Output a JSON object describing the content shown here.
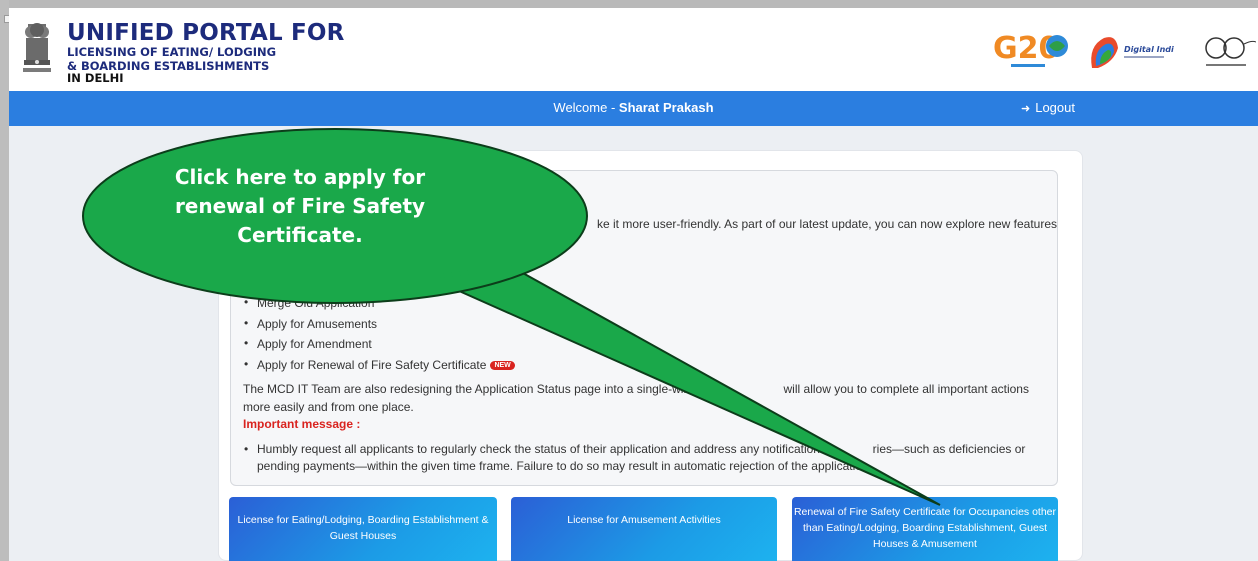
{
  "header": {
    "title_main": "UNIFIED PORTAL FOR",
    "title_line2": "LICENSING OF EATING/ LODGING",
    "title_line3": "& BOARDING ESTABLISHMENTS",
    "title_line4": "IN DELHI",
    "logos": [
      "emblem-icon",
      "g20-logo",
      "digital-india-logo",
      "swachh-bharat-logo"
    ],
    "g20_text": "G20"
  },
  "navbar": {
    "welcome_prefix": "Welcome - ",
    "user_name": "Sharat Prakash",
    "logout_label": "Logout",
    "color": "#2b7ee0"
  },
  "notice": {
    "intro_visible": "ke it more user-friendly. As part of our latest update, you can now explore new features",
    "features": [
      "Merge Old Application",
      "Apply for Amusements",
      "Apply for Amendment",
      "Apply for Renewal of Fire Safety Certificate"
    ],
    "new_badge": "NEW",
    "para_part1": "The MCD IT Team are also redesigning the Application Status page into a single-wind",
    "para_part2": "will allow you to complete all important actions more easily and from one place.",
    "important_label": "Important message :",
    "warning_part1": "Humbly request all applicants to regularly check the status of their application and address any notifications",
    "warning_part2": "ries—such as deficiencies or pending payments—within the given time frame. Failure to do so may result in automatic rejection of the application."
  },
  "tiles": [
    {
      "label": "License for Eating/Lodging, Boarding Establishment & Guest Houses"
    },
    {
      "label": "License for Amusement Activities"
    },
    {
      "label": "Renewal of Fire Safety Certificate for Occupancies other than Eating/Lodging, Boarding Establishment, Guest Houses & Amusement"
    }
  ],
  "callout": {
    "text": "Click here to apply for renewal of Fire Safety Certificate.",
    "fill": "#1aa84a"
  }
}
